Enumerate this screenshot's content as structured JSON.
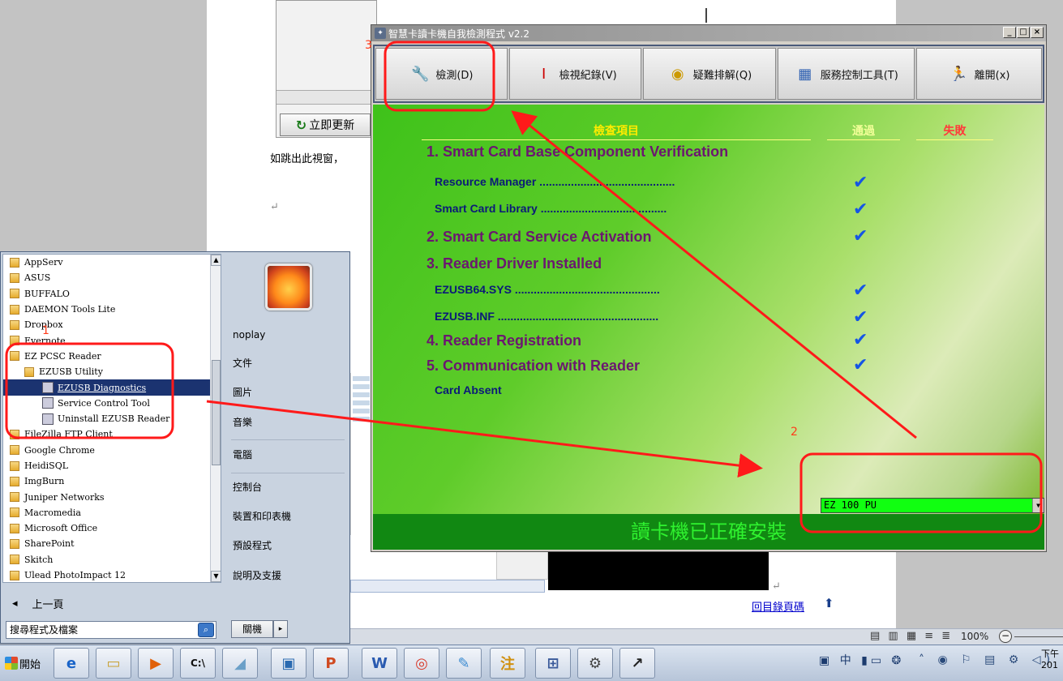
{
  "document": {
    "update_button": "立即更新",
    "doc_text": "如跳出此視窗，",
    "return_mark": "↵",
    "toc_link": "回目錄頁碼",
    "toc_arrow": "⬆",
    "status": {
      "zoom": "100%"
    }
  },
  "app": {
    "title": "智慧卡讀卡機自我檢測程式 v2.2",
    "toolbar": [
      {
        "label": "檢測(D)",
        "icon": "diagnose-icon"
      },
      {
        "label": "檢視紀錄(V)",
        "icon": "log-icon"
      },
      {
        "label": "疑難排解(Q)",
        "icon": "troubleshoot-icon"
      },
      {
        "label": "服務控制工具(T)",
        "icon": "service-tool-icon"
      },
      {
        "label": "離開(x)",
        "icon": "exit-icon"
      }
    ],
    "headers": {
      "items": "檢查項目",
      "pass": "通過",
      "fail": "失敗"
    },
    "checks": [
      {
        "label": "1. Smart Card Base Component Verification",
        "level": "main",
        "pass": false
      },
      {
        "label": "Resource Manager ...........................................",
        "level": "sub",
        "pass": true
      },
      {
        "label": "Smart Card Library ........................................",
        "level": "sub",
        "pass": true
      },
      {
        "label": "2. Smart Card Service Activation",
        "level": "main",
        "pass": true
      },
      {
        "label": "3. Reader Driver Installed",
        "level": "main",
        "pass": false
      },
      {
        "label": "EZUSB64.SYS ..............................................",
        "level": "sub",
        "pass": true
      },
      {
        "label": "EZUSB.INF ...................................................",
        "level": "sub",
        "pass": true
      },
      {
        "label": "4. Reader Registration",
        "level": "main",
        "pass": true
      },
      {
        "label": "5. Communication with Reader",
        "level": "main",
        "pass": true
      },
      {
        "label": "Card Absent",
        "level": "sub",
        "pass": false
      }
    ],
    "tick": "✔",
    "reader_select": "EZ 100 PU",
    "status_message": "讀卡機已正確安裝"
  },
  "start_menu": {
    "programs": [
      {
        "label": "AppServ",
        "type": "folder",
        "level": 0
      },
      {
        "label": "ASUS",
        "type": "folder",
        "level": 0
      },
      {
        "label": "BUFFALO",
        "type": "folder",
        "level": 0
      },
      {
        "label": "DAEMON Tools Lite",
        "type": "folder",
        "level": 0
      },
      {
        "label": "Dropbox",
        "type": "folder",
        "level": 0
      },
      {
        "label": "Evernote",
        "type": "folder",
        "level": 0
      },
      {
        "label": "EZ PCSC Reader",
        "type": "folder",
        "level": 0
      },
      {
        "label": "EZUSB Utility",
        "type": "folder",
        "level": 1
      },
      {
        "label": "EZUSB Diagnostics",
        "type": "app",
        "level": 2,
        "selected": true
      },
      {
        "label": "Service Control Tool",
        "type": "app",
        "level": 2
      },
      {
        "label": "Uninstall EZUSB Reader",
        "type": "app",
        "level": 2
      },
      {
        "label": "FileZilla FTP Client",
        "type": "folder",
        "level": 0
      },
      {
        "label": "Google Chrome",
        "type": "folder",
        "level": 0
      },
      {
        "label": "HeidiSQL",
        "type": "folder",
        "level": 0
      },
      {
        "label": "ImgBurn",
        "type": "folder",
        "level": 0
      },
      {
        "label": "Juniper Networks",
        "type": "folder",
        "level": 0
      },
      {
        "label": "Macromedia",
        "type": "folder",
        "level": 0
      },
      {
        "label": "Microsoft Office",
        "type": "folder",
        "level": 0
      },
      {
        "label": "SharePoint",
        "type": "folder",
        "level": 0
      },
      {
        "label": "Skitch",
        "type": "folder",
        "level": 0
      },
      {
        "label": "Ulead PhotoImpact 12",
        "type": "folder",
        "level": 0
      }
    ],
    "back": "上一頁",
    "search_placeholder": "搜尋程式及檔案",
    "user": "noplay",
    "right_items": [
      "文件",
      "圖片",
      "音樂",
      "電腦",
      "控制台",
      "裝置和印表機",
      "預設程式",
      "說明及支援"
    ],
    "shutdown": "關機"
  },
  "taskbar": {
    "start_label": "開始",
    "apps": [
      "internet-explorer-icon",
      "explorer-icon",
      "media-player-icon",
      "cmd-icon",
      "notepad-icon",
      "photo-icon",
      "powerpoint-icon",
      "word-icon",
      "chrome-icon",
      "paint-icon",
      "ime-icon",
      "network-icon",
      "ezusb-diagnostics-icon",
      "service-control-icon"
    ],
    "tray_text": "中",
    "clock_line1": "下午",
    "clock_line2": "201"
  },
  "annotations": [
    "1",
    "2",
    "3"
  ],
  "colors": {
    "annotation": "#ff1a1a",
    "app_status_bg": "#118812",
    "selected_item": "#1b3370",
    "tick": "#1455e5"
  }
}
